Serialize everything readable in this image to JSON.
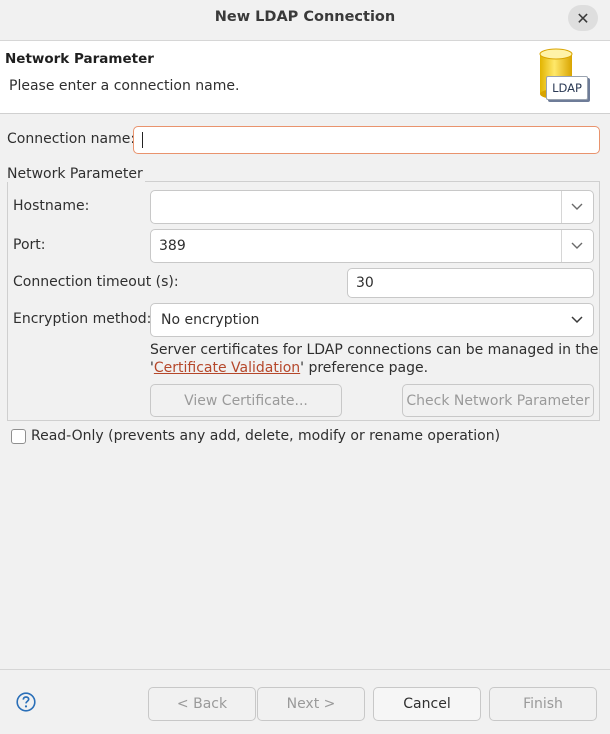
{
  "window": {
    "title": "New LDAP Connection",
    "close_icon": "close-icon"
  },
  "banner": {
    "title": "Network Parameter",
    "message": "Please enter a connection name.",
    "icon_label": "LDAP",
    "icon": "ldap-database-icon"
  },
  "connection_name": {
    "label": "Connection name:",
    "value": ""
  },
  "network_group": {
    "legend": "Network Parameter",
    "hostname": {
      "label": "Hostname:",
      "value": ""
    },
    "port": {
      "label": "Port:",
      "value": "389"
    },
    "timeout": {
      "label": "Connection timeout (s):",
      "value": "30"
    },
    "encryption": {
      "label": "Encryption method:",
      "value": "No encryption"
    },
    "cert_note": {
      "line1": "Server certificates for LDAP connections can be managed in the",
      "prefix": "'",
      "link": "Certificate Validation",
      "suffix": "' preference page."
    },
    "view_certificate_button": "View Certificate...",
    "check_network_button": "Check Network Parameter"
  },
  "read_only": {
    "label": "Read-Only (prevents any add, delete, modify or rename operation)",
    "checked": false
  },
  "footer": {
    "back": "< Back",
    "next": "Next >",
    "cancel": "Cancel",
    "finish": "Finish",
    "help_icon": "help-icon"
  },
  "colors": {
    "focus_border": "#e9936d",
    "link": "#b5472a",
    "background": "#f1f1f1"
  }
}
